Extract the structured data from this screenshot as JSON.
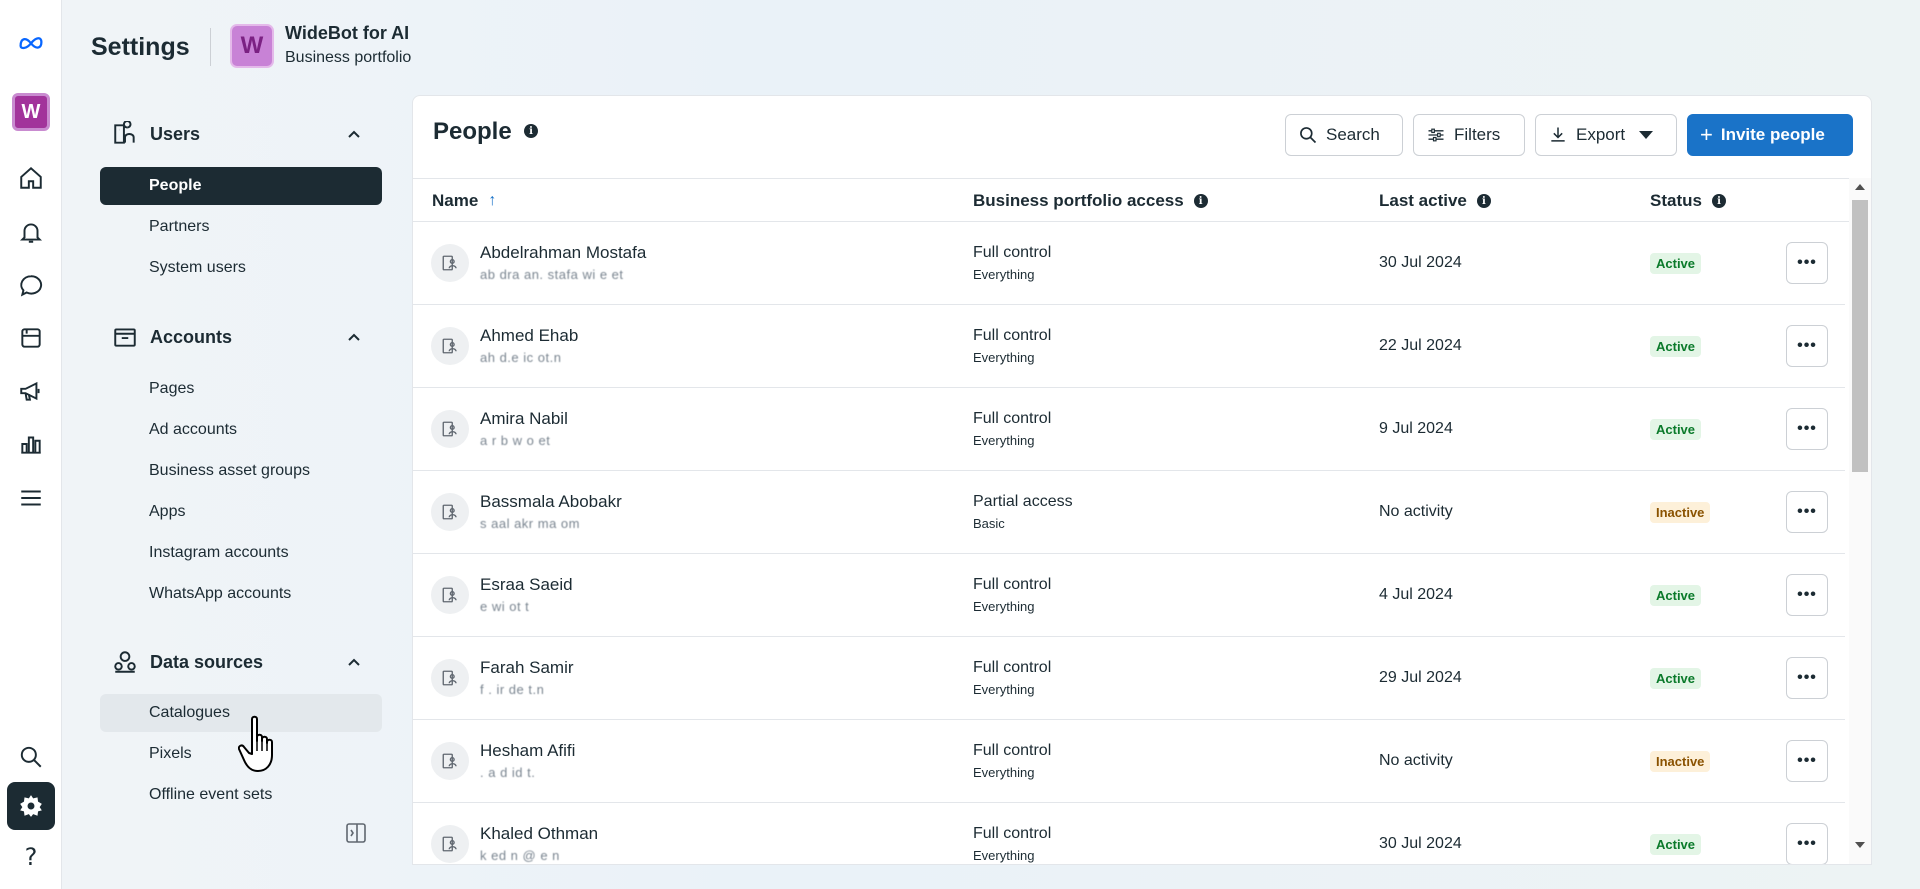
{
  "header": {
    "title": "Settings",
    "avatar_letter": "W",
    "business_name": "WideBot for AI",
    "business_sub": "Business portfolio"
  },
  "rail": {
    "avatar_letter": "W",
    "icons": [
      "meta-logo",
      "home-icon",
      "bell-icon",
      "chat-icon",
      "pages-icon",
      "megaphone-icon",
      "chart-icon",
      "menu-icon",
      "search-icon",
      "gear-icon",
      "help-icon"
    ]
  },
  "sidebar": {
    "sections": [
      {
        "label": "Users",
        "items": [
          "People",
          "Partners",
          "System users"
        ]
      },
      {
        "label": "Accounts",
        "items": [
          "Pages",
          "Ad accounts",
          "Business asset groups",
          "Apps",
          "Instagram accounts",
          "WhatsApp accounts"
        ]
      },
      {
        "label": "Data sources",
        "items": [
          "Catalogues",
          "Pixels",
          "Offline event sets"
        ]
      }
    ],
    "active_item": "People",
    "hover_item": "Catalogues"
  },
  "main": {
    "title": "People",
    "toolbar": {
      "search": "Search",
      "filters": "Filters",
      "export": "Export",
      "invite": "Invite people"
    },
    "columns": {
      "name": "Name",
      "access": "Business portfolio access",
      "last_active": "Last active",
      "status": "Status"
    },
    "rows": [
      {
        "name": "Abdelrahman Mostafa",
        "email": "ab dra an. stafa wi e et",
        "access": "Full control",
        "access_sub": "Everything",
        "last_active": "30 Jul 2024",
        "status": "Active"
      },
      {
        "name": "Ahmed Ehab",
        "email": "ah d.e ic ot.n",
        "access": "Full control",
        "access_sub": "Everything",
        "last_active": "22 Jul 2024",
        "status": "Active"
      },
      {
        "name": "Amira Nabil",
        "email": "a r b w o et",
        "access": "Full control",
        "access_sub": "Everything",
        "last_active": "9 Jul 2024",
        "status": "Active"
      },
      {
        "name": "Bassmala Abobakr",
        "email": "s aal akr ma om",
        "access": "Partial access",
        "access_sub": "Basic",
        "last_active": "No activity",
        "status": "Inactive"
      },
      {
        "name": "Esraa Saeid",
        "email": "e wi ot t",
        "access": "Full control",
        "access_sub": "Everything",
        "last_active": "4 Jul 2024",
        "status": "Active"
      },
      {
        "name": "Farah Samir",
        "email": "f . ir de t.n",
        "access": "Full control",
        "access_sub": "Everything",
        "last_active": "29 Jul 2024",
        "status": "Active"
      },
      {
        "name": "Hesham Afifi",
        "email": ". a d id t.",
        "access": "Full control",
        "access_sub": "Everything",
        "last_active": "No activity",
        "status": "Inactive"
      },
      {
        "name": "Khaled Othman",
        "email": "k ed n @ e n",
        "access": "Full control",
        "access_sub": "Everything",
        "last_active": "30 Jul 2024",
        "status": "Active"
      }
    ]
  },
  "colors": {
    "primary": "#1a73c8",
    "dark": "#1c2b33",
    "active_badge_bg": "#e3f5e6",
    "inactive_badge_bg": "#fdf0d9"
  }
}
